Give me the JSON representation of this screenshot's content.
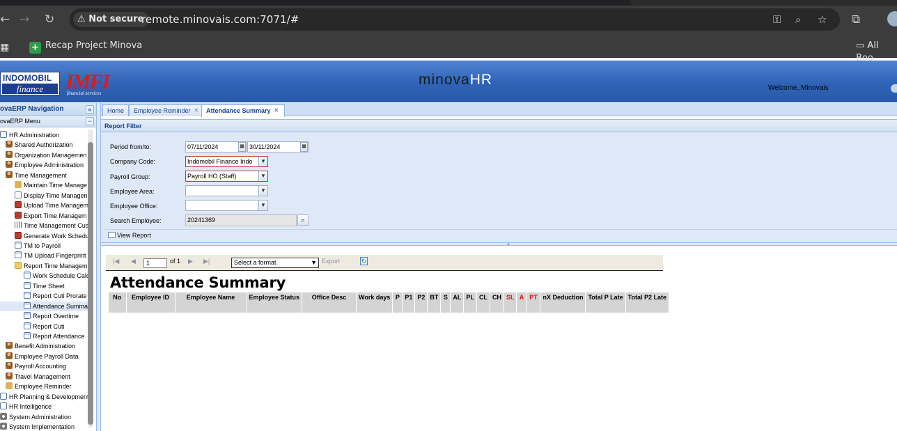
{
  "browser": {
    "security_label": "Not secure",
    "url": "remote.minovais.com:7071/#",
    "bookmark": "Recap Project Minova",
    "all_bookmarks": "All Boo"
  },
  "banner": {
    "logo_top": "INDOMOBIL",
    "logo_bottom": "finance",
    "logo2_top": "IMFI",
    "logo2_bottom": "financial services",
    "brand_dark": "minova",
    "brand_light": "HR",
    "welcome": "Welcome, Minovais"
  },
  "nav": {
    "title": "ovaERP Navigation",
    "menu_title": "ovaERP Menu",
    "items": [
      {
        "label": "HR Administration",
        "icon": "page-icon"
      },
      {
        "label": "Shared Authorization",
        "icon": "user-icon"
      },
      {
        "label": "Organization Managemen",
        "icon": "user-icon"
      },
      {
        "label": "Employee Administration",
        "icon": "user-icon"
      },
      {
        "label": "Time Management",
        "icon": "user-icon"
      },
      {
        "label": "Maintain Time Manage",
        "icon": "pencil-icon"
      },
      {
        "label": "Display Time Managen",
        "icon": "page-icon"
      },
      {
        "label": "Upload Time Managem",
        "icon": "red-icon"
      },
      {
        "label": "Export Time Managem",
        "icon": "red-icon"
      },
      {
        "label": "Time Management Cus",
        "icon": "grid-icon"
      },
      {
        "label": "Generate Work Schedu",
        "icon": "red-icon"
      },
      {
        "label": "TM to Payroll",
        "icon": "sheet-icon"
      },
      {
        "label": "TM Upload Fingerprint",
        "icon": "sheet-icon"
      },
      {
        "label": "Report Time Managem",
        "icon": "folder-icon"
      },
      {
        "label": "Work Schedule Calc",
        "icon": "sheet-icon"
      },
      {
        "label": "Time Sheet",
        "icon": "sheet-icon"
      },
      {
        "label": "Report Cuti Prorate",
        "icon": "sheet-icon"
      },
      {
        "label": "Attendance Summa",
        "icon": "sheet-icon"
      },
      {
        "label": "Report Overtime",
        "icon": "sheet-icon"
      },
      {
        "label": "Report Cuti",
        "icon": "sheet-icon"
      },
      {
        "label": "Report Attendance",
        "icon": "sheet-icon"
      },
      {
        "label": "Benefit Administration",
        "icon": "user-icon"
      },
      {
        "label": "Employee Payroll Data",
        "icon": "user-icon"
      },
      {
        "label": "Payroll Accounting",
        "icon": "user-icon"
      },
      {
        "label": "Travel Management",
        "icon": "user-icon"
      },
      {
        "label": "Employee Reminder",
        "icon": "pencil-icon"
      },
      {
        "label": "HR Planning & Development",
        "icon": "page-icon"
      },
      {
        "label": "HR Intelligence",
        "icon": "page-icon"
      },
      {
        "label": "System Administration",
        "icon": "gear-icon"
      },
      {
        "label": "System Implementation",
        "icon": "gear-icon"
      }
    ]
  },
  "tabs": [
    {
      "label": "Home"
    },
    {
      "label": "Employee Reminder"
    },
    {
      "label": "Attendance Summary"
    }
  ],
  "filter": {
    "title": "Report Filter",
    "period_label": "Period from/to:",
    "period_from": "07/11/2024",
    "period_to": "30/11/2024",
    "company_label": "Company Code:",
    "company_value": "Indomobil Finance Indo",
    "payroll_label": "Payroll Group:",
    "payroll_value": "Payroll HO (Staff)",
    "area_label": "Employee Area:",
    "area_value": "",
    "office_label": "Employee Office:",
    "office_value": "",
    "search_label": "Search Employee:",
    "search_value": "20241369",
    "view_report": "View Report"
  },
  "report": {
    "page_value": "1",
    "page_of": "of 1",
    "format_placeholder": "Select a format",
    "export": "Export",
    "title": "Attendance Summary",
    "columns": [
      {
        "label": "No"
      },
      {
        "label": "Employee ID"
      },
      {
        "label": "Employee Name"
      },
      {
        "label": "Employee Status"
      },
      {
        "label": "Office Desc"
      },
      {
        "label": "Work days"
      },
      {
        "label": "P"
      },
      {
        "label": "P1"
      },
      {
        "label": "P2"
      },
      {
        "label": "BT"
      },
      {
        "label": "S"
      },
      {
        "label": "AL"
      },
      {
        "label": "PL"
      },
      {
        "label": "CL"
      },
      {
        "label": "CH"
      },
      {
        "label": "SL",
        "color": "#e01010"
      },
      {
        "label": "A",
        "color": "#e01010"
      },
      {
        "label": "PT",
        "color": "#e01010"
      },
      {
        "label": "nX Deduction"
      },
      {
        "label": "Total P Late"
      },
      {
        "label": "Total P2 Late"
      }
    ]
  }
}
